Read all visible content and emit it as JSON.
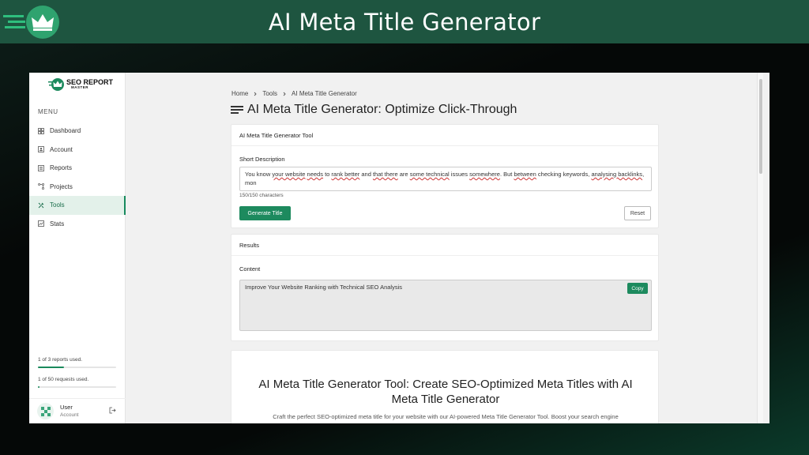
{
  "banner": {
    "title": "AI Meta Title Generator"
  },
  "sidebar": {
    "logo_main": "SEO REPORT",
    "logo_sub": "MASTER",
    "menu_label": "MENU",
    "items": [
      {
        "label": "Dashboard",
        "icon": "grid-icon",
        "active": false
      },
      {
        "label": "Account",
        "icon": "account-icon",
        "active": false
      },
      {
        "label": "Reports",
        "icon": "reports-icon",
        "active": false
      },
      {
        "label": "Projects",
        "icon": "projects-icon",
        "active": false
      },
      {
        "label": "Tools",
        "icon": "tools-icon",
        "active": true
      },
      {
        "label": "Stats",
        "icon": "stats-icon",
        "active": false
      }
    ],
    "usage": [
      {
        "text": "1 of 3 reports used.",
        "fraction": 0.33
      },
      {
        "text": "1 of 50 requests used.",
        "fraction": 0.02
      }
    ],
    "user": {
      "name": "User",
      "role": "Account"
    }
  },
  "breadcrumb": {
    "home": "Home",
    "tools": "Tools",
    "current": "AI Meta Title Generator"
  },
  "page_title": "AI Meta Title Generator: Optimize Click-Through",
  "tool_card": {
    "header": "AI Meta Title Generator Tool",
    "field_label": "Short Description",
    "text_before": "You know ",
    "text_w1": "your website",
    "text_b2": " ",
    "text_w2": "needs",
    "text_b3": " to ",
    "text_w3": "rank better",
    "text_b4": " and ",
    "text_w4": "that there",
    "text_b5": " are ",
    "text_w5": "some technical",
    "text_b6": " issues ",
    "text_w6": "somewhere",
    "text_b7": ". But ",
    "text_w7": "between",
    "text_b8": " checking keywords, ",
    "text_w8": "analysing backlinks",
    "text_after": ", mon",
    "counter": "150/150 characters",
    "generate_label": "Generate Title",
    "reset_label": "Reset"
  },
  "results_card": {
    "header": "Results",
    "content_label": "Content",
    "content_value": "Improve Your Website Ranking with Technical SEO Analysis",
    "copy_label": "Copy"
  },
  "article": {
    "title": "AI Meta Title Generator Tool: Create SEO-Optimized Meta Titles with AI Meta Title Generator",
    "intro": "Craft the perfect SEO-optimized meta title for your website with our AI-powered Meta Title Generator Tool. Boost your search engine"
  },
  "colors": {
    "brand": "#1d8a5e",
    "banner": "#1e5540"
  }
}
